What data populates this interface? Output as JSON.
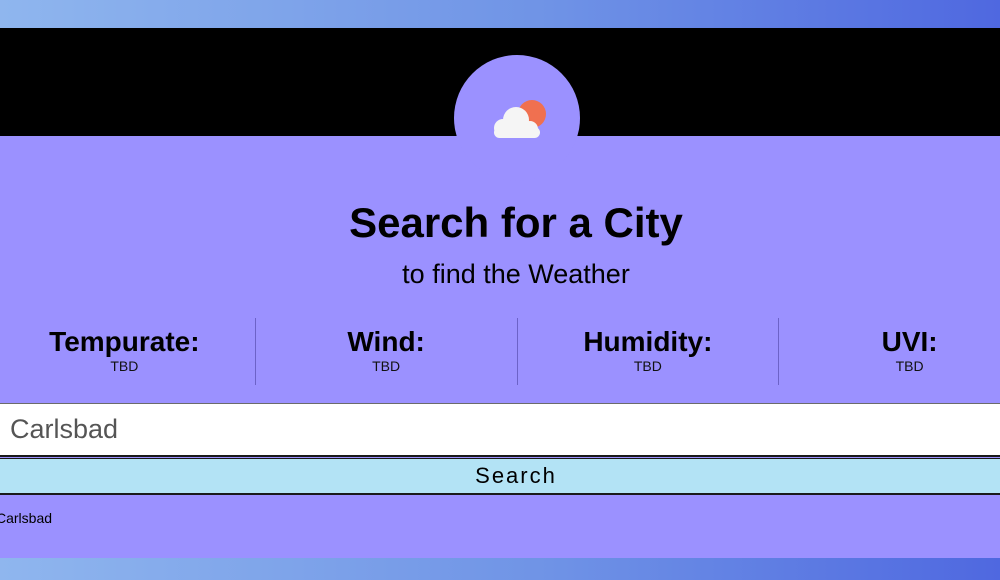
{
  "header": {
    "logo_icon": "cloud-sun-icon",
    "title": "Search for a City",
    "subtitle": "to find the Weather"
  },
  "stats": [
    {
      "label": "Tempurate:",
      "value": "TBD"
    },
    {
      "label": "Wind:",
      "value": "TBD"
    },
    {
      "label": "Humidity:",
      "value": "TBD"
    },
    {
      "label": "UVI:",
      "value": "TBD"
    }
  ],
  "search": {
    "value": "Carlsbad",
    "button_label": "Search"
  },
  "history": {
    "items": [
      "Carlsbad"
    ]
  },
  "colors": {
    "card": "#9b91ff",
    "button": "#b3e3f5",
    "sun": "#f07050",
    "cloud": "#f5f5f5"
  }
}
